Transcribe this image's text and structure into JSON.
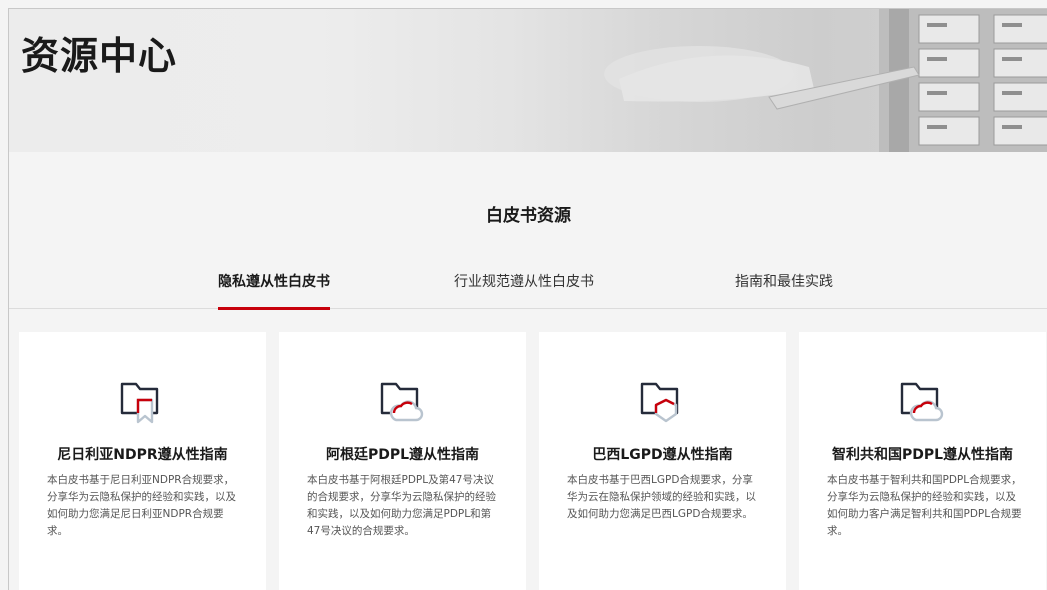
{
  "hero": {
    "title": "资源中心"
  },
  "section": {
    "title": "白皮书资源"
  },
  "tabs": [
    {
      "label": "隐私遵从性白皮书"
    },
    {
      "label": "行业规范遵从性白皮书"
    },
    {
      "label": "指南和最佳实践"
    }
  ],
  "cards": [
    {
      "title": "尼日利亚NDPR遵从性指南",
      "desc": "本白皮书基于尼日利亚NDPR合规要求，分享华为云隐私保护的经验和实践，以及如何助力您满足尼日利亚NDPR合规要求。",
      "icon": "folder-bookmark-icon"
    },
    {
      "title": "阿根廷PDPL遵从性指南",
      "desc": "本白皮书基于阿根廷PDPL及第47号决议的合规要求，分享华为云隐私保护的经验和实践，以及如何助力您满足PDPL和第47号决议的合规要求。",
      "icon": "folder-cloud-icon"
    },
    {
      "title": "巴西LGPD遵从性指南",
      "desc": "本白皮书基于巴西LGPD合规要求，分享华为云在隐私保护领域的经验和实践，以及如何助力您满足巴西LGPD合规要求。",
      "icon": "folder-shield-icon"
    },
    {
      "title": "智利共和国PDPL遵从性指南",
      "desc": "本白皮书基于智利共和国PDPL合规要求，分享华为云隐私保护的经验和实践，以及如何助力客户满足智利共和国PDPL合规要求。",
      "icon": "folder-cloud-icon"
    }
  ],
  "colors": {
    "accent": "#c7000b",
    "icon_stroke": "#252b3a",
    "icon_secondary": "#b9c4cf"
  }
}
